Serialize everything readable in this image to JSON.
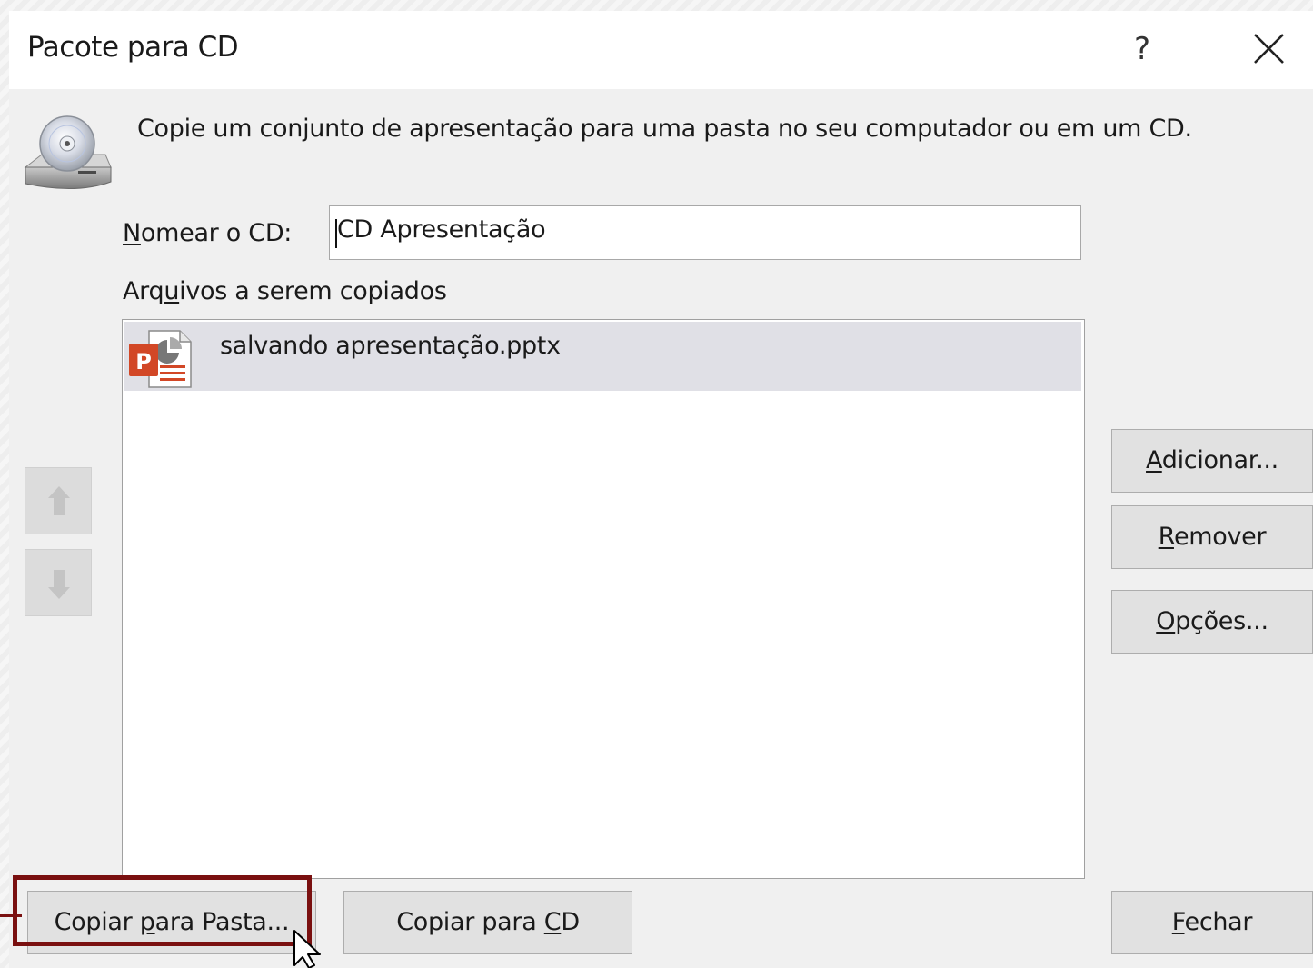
{
  "dialog": {
    "title": "Pacote para CD",
    "help_label": "?",
    "description": "Copie um conjunto de apresentação para uma pasta no seu computador ou em um CD."
  },
  "name_field": {
    "label_accel": "N",
    "label_rest": "omear o CD:",
    "value": "CD Apresentação"
  },
  "files": {
    "label_pre": "Arq",
    "label_accel": "u",
    "label_post": "ivos a serem copiados",
    "items": [
      {
        "name": "salvando apresentação.pptx",
        "icon": "powerpoint-file-icon"
      }
    ]
  },
  "side_buttons": {
    "add_accel": "A",
    "add_rest": "dicionar...",
    "remove_accel": "R",
    "remove_rest": "emover",
    "options_accel": "O",
    "options_rest": "pções..."
  },
  "bottom_buttons": {
    "copy_folder_pre": "Copiar ",
    "copy_folder_accel": "p",
    "copy_folder_post": "ara Pasta...",
    "copy_cd_pre": "Copiar para ",
    "copy_cd_accel": "C",
    "copy_cd_post": "D",
    "close_accel": "F",
    "close_rest": "echar"
  },
  "colors": {
    "highlight": "#7a1010",
    "selection": "#e0e0e6",
    "powerpoint": "#d24726"
  }
}
